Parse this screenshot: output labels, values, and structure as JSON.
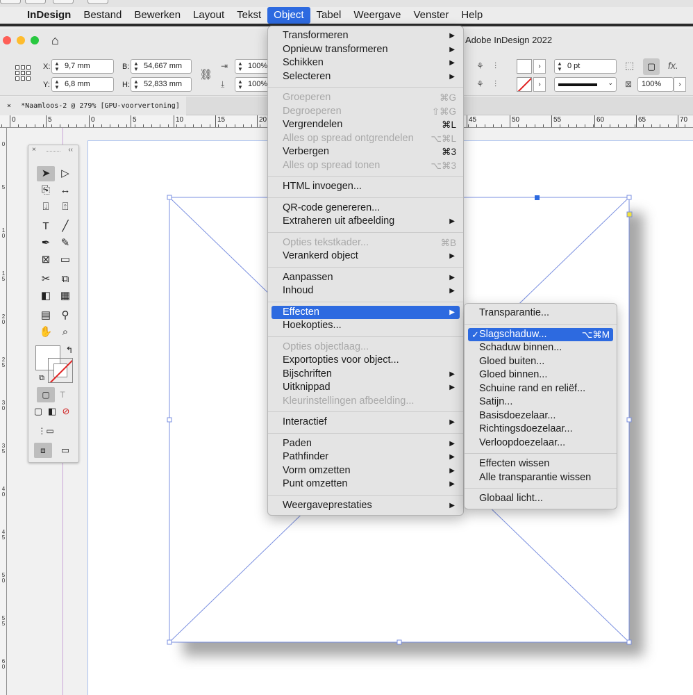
{
  "menubar": {
    "apple": "",
    "items": [
      "InDesign",
      "Bestand",
      "Bewerken",
      "Layout",
      "Tekst",
      "Object",
      "Tabel",
      "Weergave",
      "Venster",
      "Help"
    ]
  },
  "window": {
    "title": "Adobe InDesign 2022"
  },
  "controls": {
    "x_label": "X:",
    "x_value": "9,7 mm",
    "y_label": "Y:",
    "y_value": "6,8 mm",
    "w_label": "B:",
    "w_value": "54,667 mm",
    "h_label": "H:",
    "h_value": "52,833 mm",
    "scale_x": "100%",
    "scale_y": "100%",
    "stroke_weight": "0 pt",
    "opacity": "100%",
    "fx": "fx."
  },
  "document_tab": {
    "close": "×",
    "title": "*Naamloos-2 @ 279% [GPU-voorvertoning]"
  },
  "ruler": {
    "labels": [
      "0",
      "5",
      "0",
      "5",
      "10",
      "15",
      "20",
      "45",
      "50",
      "55",
      "60",
      "65",
      "70"
    ]
  },
  "vruler": {
    "labels": [
      "0",
      "5",
      "1\n0",
      "1\n5",
      "2\n0",
      "2\n5",
      "3\n0",
      "3\n5",
      "4\n0",
      "4\n5",
      "5\n0",
      "5\n5",
      "6\n0"
    ]
  },
  "tools_panel": {
    "close": "×",
    "collapse": "‹‹"
  },
  "object_menu": {
    "items": [
      {
        "label": "Transformeren",
        "submenu": true
      },
      {
        "label": "Opnieuw transformeren",
        "submenu": true
      },
      {
        "label": "Schikken",
        "submenu": true
      },
      {
        "label": "Selecteren",
        "submenu": true
      },
      {
        "sep": true
      },
      {
        "label": "Groeperen",
        "shortcut": "⌘G",
        "disabled": true
      },
      {
        "label": "Degroeperen",
        "shortcut": "⇧⌘G",
        "disabled": true
      },
      {
        "label": "Vergrendelen",
        "shortcut": "⌘L"
      },
      {
        "label": "Alles op spread ontgrendelen",
        "shortcut": "⌥⌘L",
        "disabled": true
      },
      {
        "label": "Verbergen",
        "shortcut": "⌘3"
      },
      {
        "label": "Alles op spread tonen",
        "shortcut": "⌥⌘3",
        "disabled": true
      },
      {
        "sep": true
      },
      {
        "label": "HTML invoegen..."
      },
      {
        "sep": true
      },
      {
        "label": "QR-code genereren..."
      },
      {
        "label": "Extraheren uit afbeelding",
        "submenu": true
      },
      {
        "sep": true
      },
      {
        "label": "Opties tekstkader...",
        "shortcut": "⌘B",
        "disabled": true
      },
      {
        "label": "Verankerd object",
        "submenu": true
      },
      {
        "sep": true
      },
      {
        "label": "Aanpassen",
        "submenu": true
      },
      {
        "label": "Inhoud",
        "submenu": true
      },
      {
        "sep": true
      },
      {
        "label": "Effecten",
        "submenu": true,
        "highlighted": true
      },
      {
        "label": "Hoekopties..."
      },
      {
        "sep": true
      },
      {
        "label": "Opties objectlaag...",
        "disabled": true
      },
      {
        "label": "Exportopties voor object..."
      },
      {
        "label": "Bijschriften",
        "submenu": true
      },
      {
        "label": "Uitknippad",
        "submenu": true
      },
      {
        "label": "Kleurinstellingen afbeelding...",
        "disabled": true
      },
      {
        "sep": true
      },
      {
        "label": "Interactief",
        "submenu": true
      },
      {
        "sep": true
      },
      {
        "label": "Paden",
        "submenu": true
      },
      {
        "label": "Pathfinder",
        "submenu": true
      },
      {
        "label": "Vorm omzetten",
        "submenu": true
      },
      {
        "label": "Punt omzetten",
        "submenu": true
      },
      {
        "sep": true
      },
      {
        "label": "Weergaveprestaties",
        "submenu": true
      }
    ]
  },
  "effects_menu": {
    "items": [
      {
        "label": "Transparantie..."
      },
      {
        "sep": true
      },
      {
        "label": "Slagschaduw...",
        "shortcut": "⌥⌘M",
        "checked": true,
        "highlighted": true
      },
      {
        "label": "Schaduw binnen..."
      },
      {
        "label": "Gloed buiten..."
      },
      {
        "label": "Gloed binnen..."
      },
      {
        "label": "Schuine rand en reliëf..."
      },
      {
        "label": "Satijn..."
      },
      {
        "label": "Basisdoezelaar..."
      },
      {
        "label": "Richtingsdoezelaar..."
      },
      {
        "label": "Verloopdoezelaar..."
      },
      {
        "sep": true
      },
      {
        "label": "Effecten wissen"
      },
      {
        "label": "Alle transparantie wissen"
      },
      {
        "sep": true
      },
      {
        "label": "Globaal licht..."
      }
    ]
  },
  "colors": {
    "accent": "#2d6ae0",
    "frame": "#7a8fe0",
    "shadow": "#9a9a9a"
  }
}
